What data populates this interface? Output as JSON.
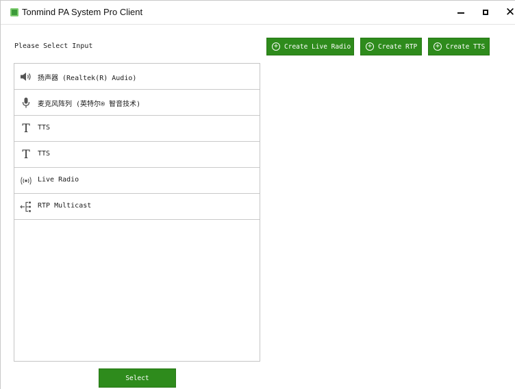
{
  "window": {
    "title": "Tonmind PA System Pro Client",
    "minimize_icon": "minimize-icon",
    "maximize_icon": "maximize-icon",
    "close_icon": "close-icon",
    "close_glyph": "✕"
  },
  "input_panel": {
    "label": "Please Select Input",
    "items": [
      {
        "label": "扬声器 (Realtek(R) Audio)",
        "icon": "speaker-icon"
      },
      {
        "label": "麦克风阵列 (英特尔® 智音技术)",
        "icon": "microphone-icon"
      },
      {
        "label": "TTS",
        "icon": "text-icon"
      },
      {
        "label": "TTS",
        "icon": "text-icon"
      },
      {
        "label": "Live Radio",
        "icon": "radio-broadcast-icon"
      },
      {
        "label": "RTP Multicast",
        "icon": "multicast-icon"
      }
    ],
    "select_label": "Select"
  },
  "toolbar": {
    "create_live_radio": "Create Live Radio",
    "create_rtp": "Create RTP",
    "create_tts": "Create TTS",
    "plus_glyph": "+"
  },
  "colors": {
    "accent_green": "#2e8b1c",
    "app_icon_green": "#3c9a3a"
  }
}
